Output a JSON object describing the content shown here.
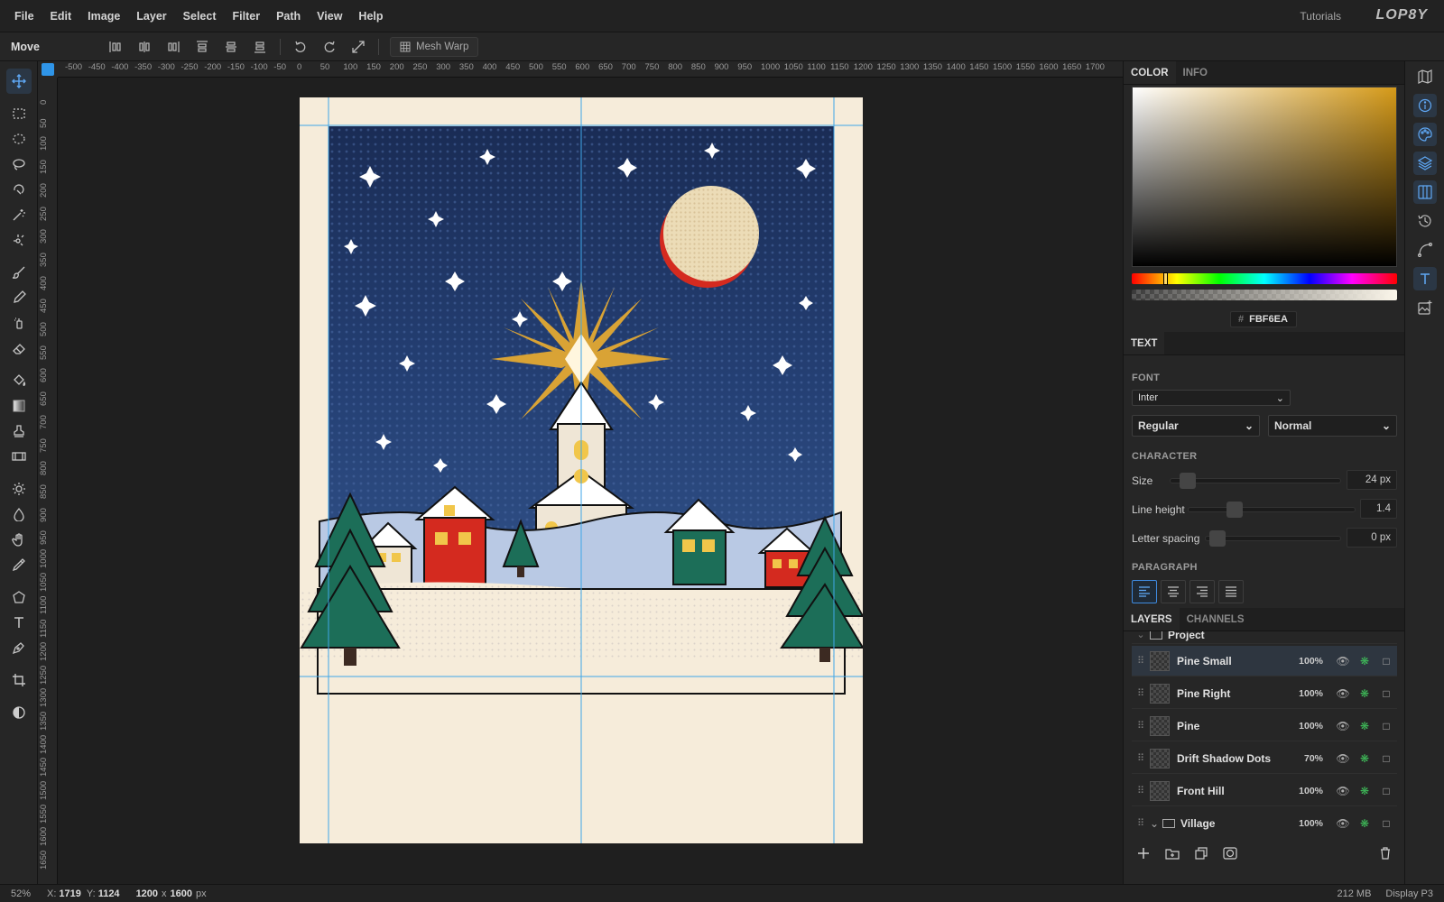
{
  "menu": [
    "File",
    "Edit",
    "Image",
    "Layer",
    "Select",
    "Filter",
    "Path",
    "View",
    "Help"
  ],
  "header": {
    "tutorials": "Tutorials",
    "logo": "LOP8Y"
  },
  "options": {
    "tool_name": "Move",
    "mesh_warp": "Mesh Warp"
  },
  "ruler_top": [
    "-500",
    "-450",
    "-400",
    "-350",
    "-300",
    "-250",
    "-200",
    "-150",
    "-100",
    "-50",
    "0",
    "50",
    "100",
    "150",
    "200",
    "250",
    "300",
    "350",
    "400",
    "450",
    "500",
    "550",
    "600",
    "650",
    "700",
    "750",
    "800",
    "850",
    "900",
    "950",
    "1000",
    "1050",
    "1100",
    "1150",
    "1200",
    "1250",
    "1300",
    "1350",
    "1400",
    "1450",
    "1500",
    "1550",
    "1600",
    "1650",
    "1700"
  ],
  "ruler_left": [
    "0",
    "50",
    "100",
    "150",
    "200",
    "250",
    "300",
    "350",
    "400",
    "450",
    "500",
    "550",
    "600",
    "650",
    "700",
    "750",
    "800",
    "850",
    "900",
    "950",
    "1000",
    "1050",
    "1100",
    "1150",
    "1200",
    "1250",
    "1300",
    "1350",
    "1400",
    "1450",
    "1500",
    "1550",
    "1600",
    "1650"
  ],
  "color_panel": {
    "tab_color": "COLOR",
    "tab_info": "INFO",
    "hex_symbol": "#",
    "hex": "FBF6EA",
    "hue_position": 0.12
  },
  "text_panel": {
    "title": "TEXT",
    "font_label": "FONT",
    "font": "Inter",
    "weight": "Regular",
    "style": "Normal",
    "character_label": "CHARACTER",
    "size_label": "Size",
    "size": "24 px",
    "line_height_label": "Line height",
    "line_height": "1.4",
    "letter_spacing_label": "Letter spacing",
    "letter_spacing": "0 px",
    "paragraph_label": "PARAGRAPH"
  },
  "layers_panel": {
    "tab_layers": "LAYERS",
    "tab_channels": "CHANNELS",
    "group": "Project",
    "layers": [
      {
        "name": "Pine Small",
        "opacity": "100%"
      },
      {
        "name": "Pine Right",
        "opacity": "100%"
      },
      {
        "name": "Pine",
        "opacity": "100%"
      },
      {
        "name": "Drift Shadow Dots",
        "opacity": "70%"
      },
      {
        "name": "Front Hill",
        "opacity": "100%"
      },
      {
        "name": "Village",
        "opacity": "100%"
      }
    ]
  },
  "status": {
    "zoom": "52%",
    "x_label": "X:",
    "x": "1719",
    "y_label": "Y:",
    "y": "1124",
    "doc_w": "1200",
    "x_sep": "x",
    "doc_h": "1600",
    "units": "px",
    "memory": "212 MB",
    "profile": "Display P3"
  },
  "colors": {
    "accent": "#2f95e8",
    "sky": "#1e3563",
    "paper": "#f6ecda",
    "moon": "#ecdcb7",
    "red": "#d42a1f",
    "green": "#1c6e58",
    "gold": "#d9a335"
  }
}
